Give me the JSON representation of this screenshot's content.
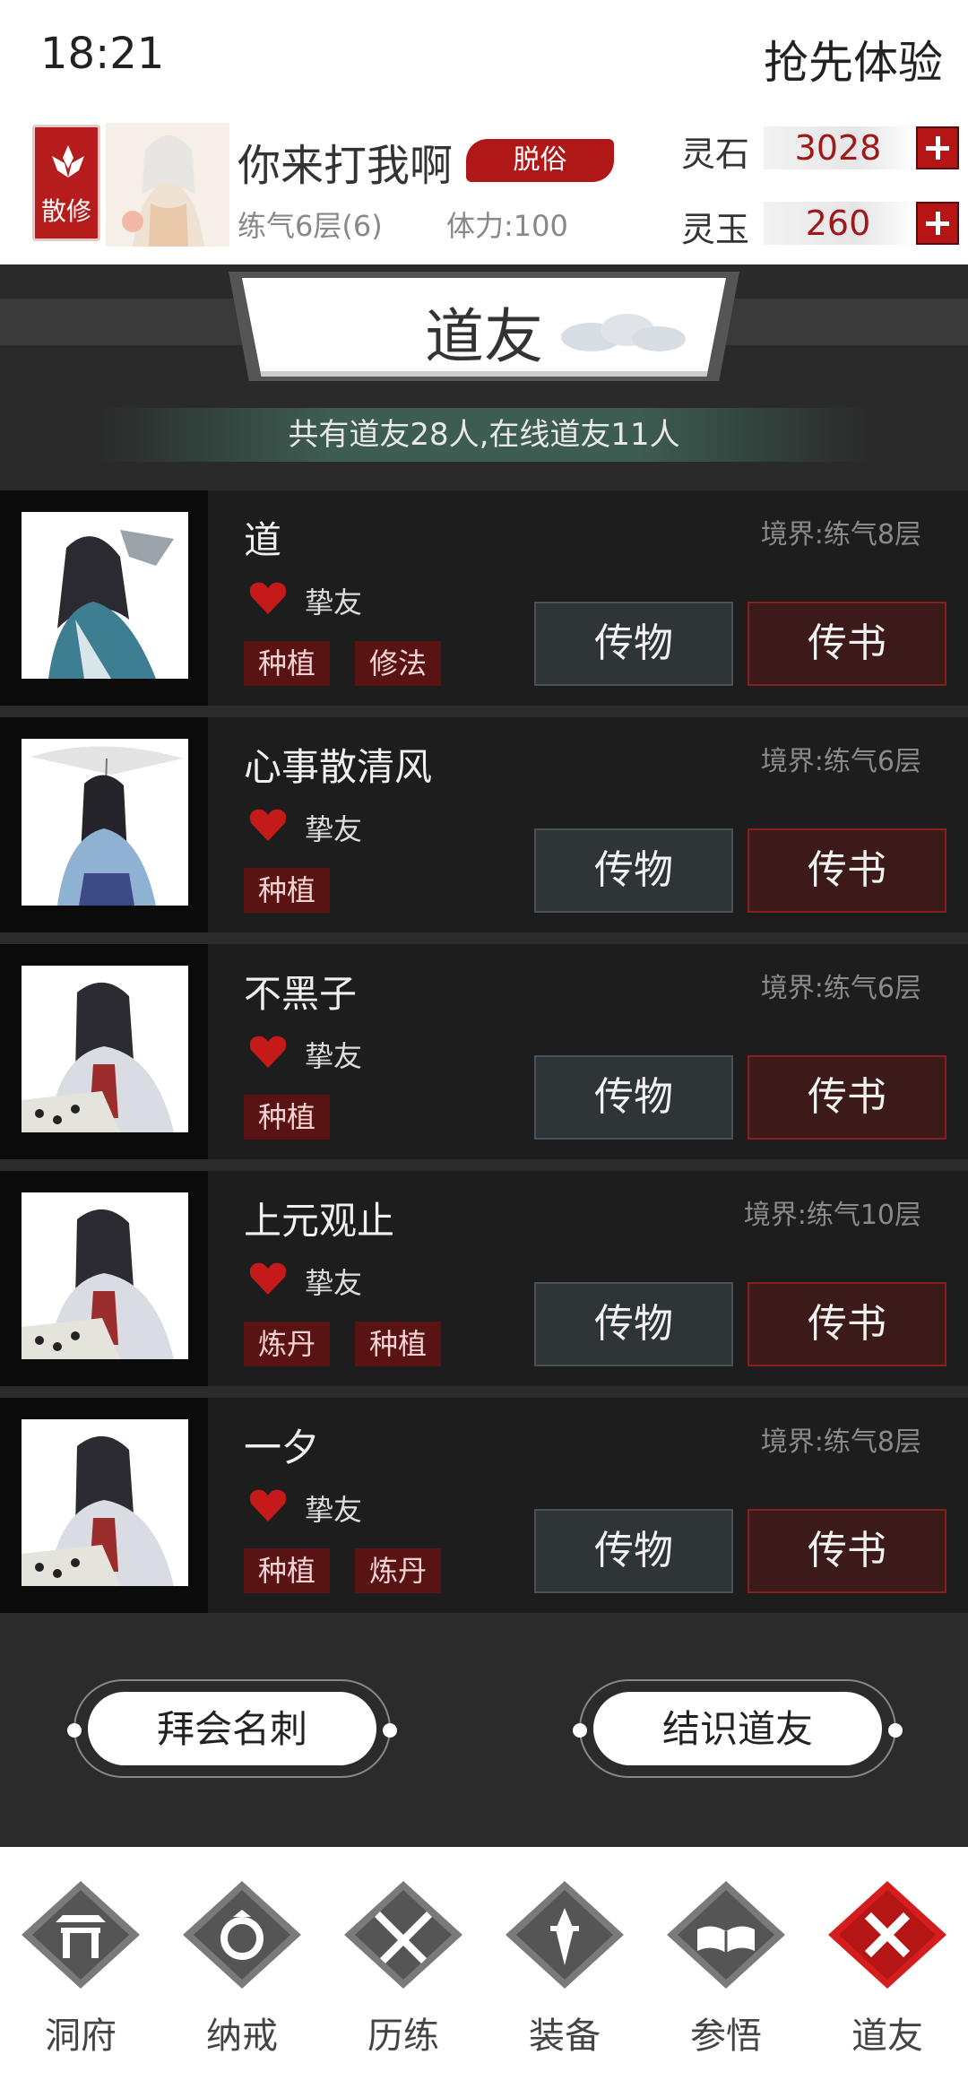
{
  "status_bar": {
    "time": "18:21",
    "early_access": "抢先体验"
  },
  "player": {
    "sect": "散修",
    "name": "你来打我啊",
    "rank_badge": "脱俗",
    "level": "练气6层(6)",
    "stamina": "体力:100"
  },
  "currencies": [
    {
      "label": "灵石",
      "value": "3028"
    },
    {
      "label": "灵玉",
      "value": "260"
    }
  ],
  "page": {
    "title": "道友",
    "summary": "共有道友28人,在线道友11人"
  },
  "friends": [
    {
      "name": "道",
      "realm": "境界:练气8层",
      "relation": "挚友",
      "tags": [
        "种植",
        "修法"
      ]
    },
    {
      "name": "心事散清风",
      "realm": "境界:练气6层",
      "relation": "挚友",
      "tags": [
        "种植"
      ]
    },
    {
      "name": "不黑子",
      "realm": "境界:练气6层",
      "relation": "挚友",
      "tags": [
        "种植"
      ]
    },
    {
      "name": "上元观止",
      "realm": "境界:练气10层",
      "relation": "挚友",
      "tags": [
        "炼丹",
        "种植"
      ]
    },
    {
      "name": "一夕",
      "realm": "境界:练气8层",
      "relation": "挚友",
      "tags": [
        "种植",
        "炼丹"
      ]
    }
  ],
  "friend_buttons": {
    "gift": "传物",
    "letter": "传书"
  },
  "actions": {
    "visit_card": "拜会名刺",
    "make_friends": "结识道友"
  },
  "nav": [
    {
      "label": "洞府",
      "icon": "gate-icon",
      "active": false
    },
    {
      "label": "纳戒",
      "icon": "ring-icon",
      "active": false
    },
    {
      "label": "历练",
      "icon": "crossed-swords-icon",
      "active": false
    },
    {
      "label": "装备",
      "icon": "dagger-icon",
      "active": false
    },
    {
      "label": "参悟",
      "icon": "book-icon",
      "active": false
    },
    {
      "label": "道友",
      "icon": "close-icon",
      "active": true
    }
  ],
  "colors": {
    "accent": "#b51515",
    "card_bg": "#1d1d1d",
    "page_bg": "#2b2b2b"
  }
}
